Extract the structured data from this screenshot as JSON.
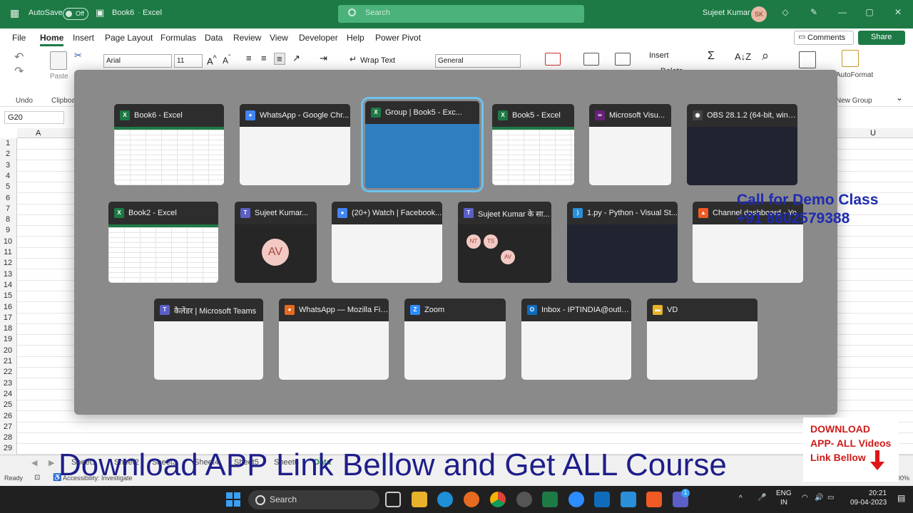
{
  "titlebar": {
    "autosave_label": "AutoSave",
    "autosave_state": "Off",
    "doc_name": "Book6",
    "app_name": "Excel",
    "search_placeholder": "Search",
    "user_name": "Sujeet Kumar",
    "user_initials": "SK"
  },
  "menu": {
    "items": [
      "File",
      "Home",
      "Insert",
      "Page Layout",
      "Formulas",
      "Data",
      "Review",
      "View",
      "Developer",
      "Help",
      "Power Pivot"
    ],
    "active": "Home",
    "comments_label": "Comments",
    "share_label": "Share"
  },
  "ribbon": {
    "undo_label": "Undo",
    "paste_label": "Paste",
    "clipboard_label": "Clipboar",
    "font_name": "Arial",
    "font_size": "11",
    "wrap_text_label": "Wrap Text",
    "number_format": "General",
    "insert_label": "Insert",
    "delete_label": "Delete",
    "autoformat_label": "AutoFormat",
    "new_group_label": "New Group"
  },
  "sheet": {
    "name_box": "G20",
    "col_a": "A",
    "col_u": "U",
    "rows": [
      "1",
      "2",
      "3",
      "4",
      "5",
      "6",
      "7",
      "8",
      "9",
      "10",
      "11",
      "12",
      "13",
      "14",
      "15",
      "16",
      "17",
      "18",
      "19",
      "20",
      "21",
      "22",
      "23",
      "24",
      "25",
      "26",
      "27",
      "28",
      "29"
    ]
  },
  "switcher": {
    "windows": [
      {
        "title": "Book6 - Excel",
        "app": "excel"
      },
      {
        "title": "WhatsApp - Google Chr...",
        "app": "chrome"
      },
      {
        "title": "Group | Book5 - Exc...",
        "app": "excel"
      },
      {
        "title": "Book5 - Excel",
        "app": "excel"
      },
      {
        "title": "Microsoft Visu...",
        "app": "vs"
      },
      {
        "title": "OBS 28.1.2 (64-bit, wind...",
        "app": "obs"
      },
      {
        "title": "Book2 - Excel",
        "app": "excel"
      },
      {
        "title": "Sujeet Kumar...",
        "app": "teams"
      },
      {
        "title": "(20+) Watch | Facebook...",
        "app": "chrome"
      },
      {
        "title": "Sujeet Kumar के सा...",
        "app": "teams"
      },
      {
        "title": "1.py - Python - Visual St...",
        "app": "vscode"
      },
      {
        "title": "Channel dashboard - Yo",
        "app": "brave"
      },
      {
        "title": "कैलेंडर | Microsoft Teams",
        "app": "teams"
      },
      {
        "title": "WhatsApp — Mozilla Fir...",
        "app": "firefox"
      },
      {
        "title": "Zoom",
        "app": "zoom"
      },
      {
        "title": "Inbox - IPTINDIA@outlo...",
        "app": "outlook"
      },
      {
        "title": "VD",
        "app": "folder"
      }
    ],
    "selected_index": 2,
    "teams_avatar": "AV",
    "call_avatars": [
      "NT",
      "TS",
      "AV"
    ]
  },
  "overlay": {
    "demo_line1": "Call for Demo Class",
    "demo_line2": "+91 8802579388",
    "banner": "Download APP Link Bellow and Get ALL Course",
    "download_line1": "DOWNLOAD",
    "download_line2": "APP- ALL Videos",
    "download_line3": "Link Bellow"
  },
  "tabs": {
    "items": [
      "Sheet1",
      "Sheet2",
      "Sheet3",
      "Sheet4",
      "Sheet5",
      "Sheet6",
      "Data"
    ]
  },
  "status": {
    "ready": "Ready",
    "accessibility": "Accessibility: Investigate",
    "zoom": "100%"
  },
  "taskbar": {
    "search_label": "Search",
    "lang_line1": "ENG",
    "lang_line2": "IN",
    "time": "20:21",
    "date": "09-04-2023",
    "teams_badge": "1"
  },
  "colors": {
    "excel_green": "#1d7a45",
    "switcher_bg": "#8a8a8a",
    "selected_outline": "#6cc2f0",
    "demo_text": "#1f2bb0",
    "download_text": "#d11a1a"
  }
}
